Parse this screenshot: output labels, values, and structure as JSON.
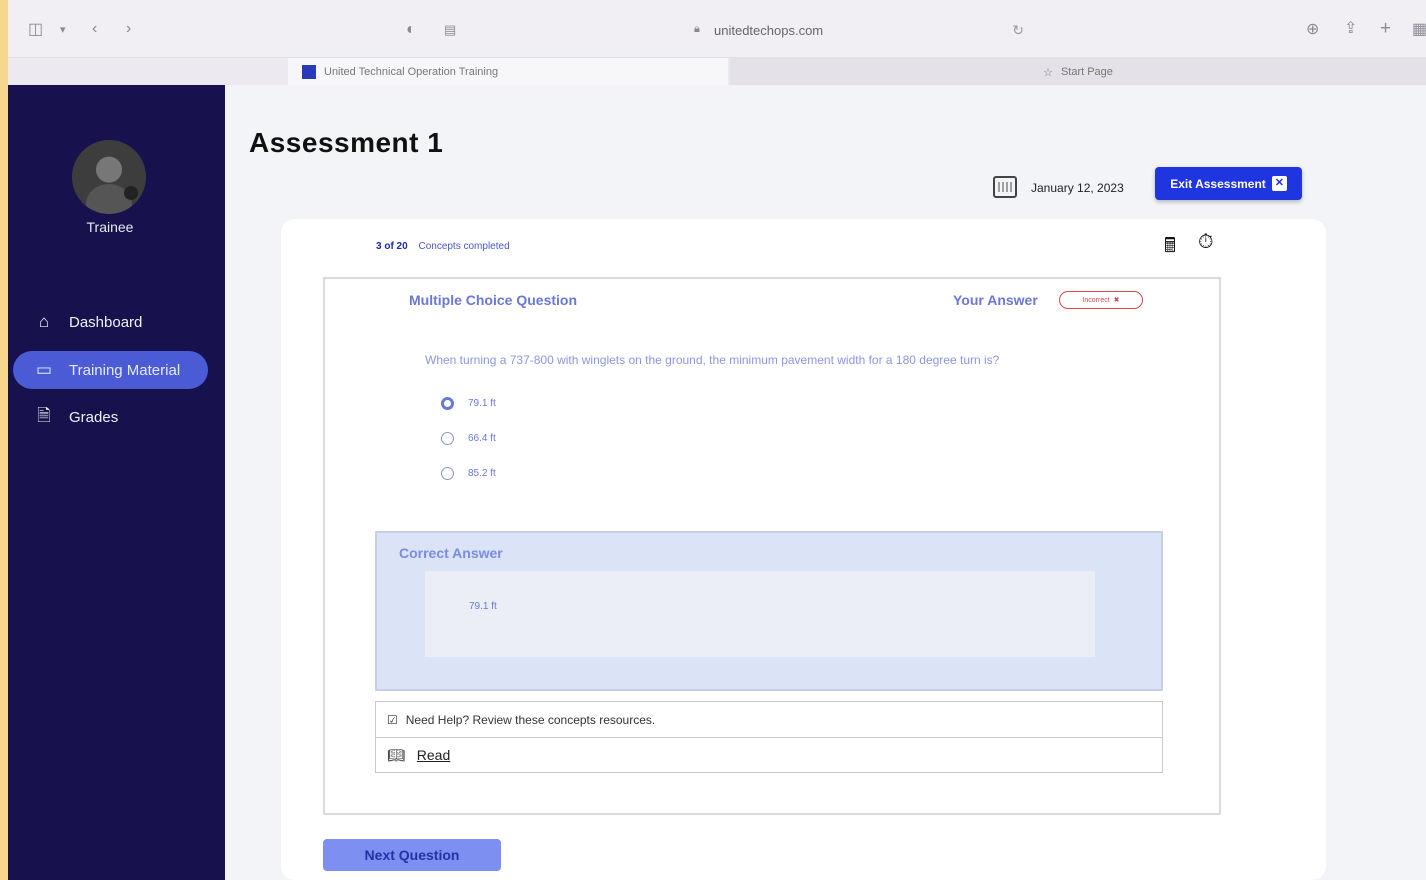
{
  "browser": {
    "url": "unitedtechops.com",
    "tabs": [
      {
        "label": "United Technical Operation Training"
      },
      {
        "label": "Start Page"
      }
    ]
  },
  "sidebar": {
    "user_role": "Trainee",
    "items": [
      {
        "label": "Dashboard",
        "icon": "home-icon"
      },
      {
        "label": "Training Material",
        "icon": "laptop-icon"
      },
      {
        "label": "Grades",
        "icon": "document-icon"
      }
    ]
  },
  "page": {
    "title": "Assessment 1",
    "date": "January 12, 2023",
    "exit_label": "Exit Assessment"
  },
  "progress": {
    "count": "3 of 20",
    "label": "Concepts completed"
  },
  "question": {
    "type": "Multiple Choice Question",
    "your_answer_label": "Your Answer",
    "answer_status": "Incorrect",
    "text": "When turning a 737-800 with winglets on the ground, the minimum pavement width for a 180 degree turn is?",
    "options": [
      "79.1 ft",
      "66.4 ft",
      "85.2 ft"
    ],
    "selected_index": 0
  },
  "correct": {
    "title": "Correct Answer",
    "value": "79.1 ft"
  },
  "help": {
    "text": "Need Help? Review these  concepts resources.",
    "link": "Read"
  },
  "next_label": "Next Question",
  "colors": {
    "sidebar": "#17124d",
    "accent": "#1f35e0",
    "active_nav": "#4b5bd6"
  }
}
